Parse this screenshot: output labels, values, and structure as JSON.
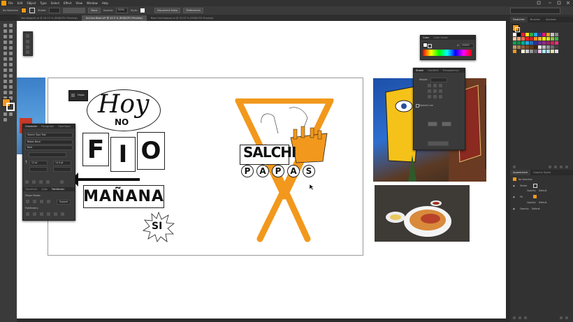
{
  "app": {
    "menus": [
      "File",
      "Edit",
      "Object",
      "Type",
      "Select",
      "Effect",
      "View",
      "Window",
      "Help"
    ]
  },
  "controlbar": {
    "selection": "No Selection",
    "stroke_label": "Stroke:",
    "brush": "Basic",
    "opacity_label": "Opacity:",
    "opacity_value": "100%",
    "style_label": "Style:",
    "doc_setup": "Document Setup",
    "preferences": "Preferences"
  },
  "tabs": [
    "Worldlogo01.ai @ 18.13 % (RGB/CPU Preview)",
    "Archivo Base.ai* @ 40.5 % (RGB/CPU Preview)",
    "Base Salchipapas.ai @ 33.33 % (RGB/CPU Preview)"
  ],
  "right_panel": {
    "tabs": [
      "Swatches",
      "Brushes",
      "Symbols"
    ],
    "appearance_tabs": [
      "Appearance",
      "Graphic Styles"
    ],
    "no_selection": "No Selection",
    "stroke_label": "Stroke",
    "fill_label": "Fill",
    "opacity_label": "Opacity:",
    "opacity_default": "Default"
  },
  "character_panel": {
    "tabs": [
      "Character",
      "Paragraph",
      "OpenType"
    ],
    "search": "Search Type Text",
    "font": "Bebas Neue",
    "style": "Bold",
    "size": "12 pt",
    "leading": "14.4 pt",
    "ops": "Shape Modes:",
    "pathfinders": "Pathfinders:",
    "sub_tabs": [
      "Transform",
      "Align",
      "Pathfinder"
    ],
    "expand": "Expand"
  },
  "color_panel": {
    "tabs": [
      "Color",
      "Color Guide"
    ],
    "hex": "FFFFFF"
  },
  "stroke_panel": {
    "tabs": [
      "Stroke",
      "Gradient",
      "Transparency"
    ],
    "weight_label": "Weight:",
    "dashed": "Dashed Line"
  },
  "artwork": {
    "hoy": "Hoy",
    "no": "NO",
    "fio": [
      "F",
      "I",
      "O"
    ],
    "manana": "MAÑANA",
    "si": "SI",
    "salchi": "SALCHI",
    "papas": [
      "P",
      "A",
      "P",
      "A",
      "S"
    ]
  },
  "tooltip": {
    "text": "Hojas"
  },
  "colors": {
    "accent": "#f2981c",
    "ui_dark": "#323232",
    "ui_mid": "#3a3a3a",
    "canvas": "#ffffff"
  }
}
